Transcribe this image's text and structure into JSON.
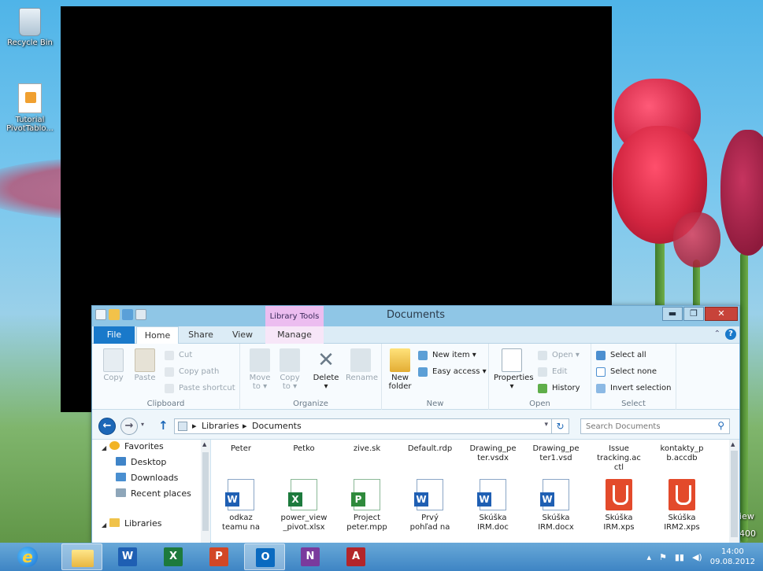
{
  "desktop": {
    "icons": [
      {
        "label": "Recycle Bin"
      },
      {
        "label_line1": "Tutorial",
        "label_line2": "PivotTablo..."
      }
    ],
    "right_edge_text": {
      "line1": "iew",
      "line2": "400"
    }
  },
  "explorer": {
    "title": "Documents",
    "contextual_tab_group": "Library Tools",
    "window_buttons": {
      "minimize": "▬",
      "maximize": "❐",
      "close": "✕"
    },
    "tabs": {
      "file": "File",
      "home": "Home",
      "share": "Share",
      "view": "View",
      "manage": "Manage"
    },
    "ribbon": {
      "clipboard": {
        "label": "Clipboard",
        "copy": "Copy",
        "paste": "Paste",
        "cut": "Cut",
        "copy_path": "Copy path",
        "paste_shortcut": "Paste shortcut"
      },
      "organize": {
        "label": "Organize",
        "move_to_1": "Move",
        "move_to_2": "to ▾",
        "copy_to_1": "Copy",
        "copy_to_2": "to ▾",
        "delete": "Delete",
        "delete_caret": "▾",
        "rename": "Rename"
      },
      "new": {
        "label": "New",
        "new_folder_1": "New",
        "new_folder_2": "folder",
        "new_item": "New item ▾",
        "easy_access": "Easy access ▾"
      },
      "open": {
        "label": "Open",
        "properties": "Properties",
        "properties_caret": "▾",
        "open": "Open ▾",
        "edit": "Edit",
        "history": "History"
      },
      "select": {
        "label": "Select",
        "select_all": "Select all",
        "select_none": "Select none",
        "invert_selection": "Invert selection"
      }
    },
    "address": {
      "back": "←",
      "forward": "→",
      "recent_caret": "▾",
      "up": "↑",
      "crumb_sep1": "▸",
      "crumb1": "Libraries",
      "crumb_sep2": "▸",
      "crumb2": "Documents",
      "dropdown": "▾",
      "refresh": "↻",
      "search_placeholder": "Search Documents",
      "search_icon": "⚲"
    },
    "navpane": {
      "favorites": "Favorites",
      "desktop": "Desktop",
      "downloads": "Downloads",
      "recent_places": "Recent places",
      "libraries": "Libraries",
      "caret_open": "◢"
    },
    "files_row1": [
      {
        "name": "Peter"
      },
      {
        "name": "Petko"
      },
      {
        "name": "zive.sk"
      },
      {
        "name": "Default.rdp"
      },
      {
        "name": "Drawing_pe",
        "name2": "ter.vsdx"
      },
      {
        "name": "Drawing_pe",
        "name2": "ter1.vsd"
      },
      {
        "name": "Issue",
        "name2": "tracking.ac",
        "name3": "ctl"
      },
      {
        "name": "kontakty_p",
        "name2": "b.accdb"
      }
    ],
    "files_row2": [
      {
        "name": "odkaz",
        "name2": "teamu na",
        "type": "word"
      },
      {
        "name": "power_view",
        "name2": "_pivot.xlsx",
        "type": "excel"
      },
      {
        "name": "Project",
        "name2": "peter.mpp",
        "type": "project"
      },
      {
        "name": "Prvý",
        "name2": "pohľad na",
        "type": "word"
      },
      {
        "name": "Skúška",
        "name2": "IRM.doc",
        "type": "word"
      },
      {
        "name": "Skúška",
        "name2": "IRM.docx",
        "type": "word"
      },
      {
        "name": "Skúška",
        "name2": "IRM.xps",
        "type": "xps"
      },
      {
        "name": "Skúška",
        "name2": "IRM2.xps",
        "type": "xps"
      }
    ]
  },
  "taskbar": {
    "apps": [
      {
        "name": "internet-explorer",
        "glyph": "e"
      },
      {
        "name": "file-explorer"
      },
      {
        "name": "word",
        "glyph": "W",
        "color": "#1f5fb3"
      },
      {
        "name": "excel",
        "glyph": "X",
        "color": "#1d7a3d"
      },
      {
        "name": "powerpoint",
        "glyph": "P",
        "color": "#d24726"
      },
      {
        "name": "outlook",
        "glyph": "O",
        "color": "#0a6ac0"
      },
      {
        "name": "onenote",
        "glyph": "N",
        "color": "#7a3b9d"
      },
      {
        "name": "access",
        "glyph": "A",
        "color": "#b3252a"
      }
    ],
    "tray": {
      "up": "▴",
      "flag": "⚑",
      "network": "▮▮",
      "volume": "◀)"
    },
    "clock": {
      "time": "14:00",
      "date": "09.08.2012"
    }
  },
  "colors": {
    "accent": "#1979ca",
    "contextual_tab": "#ecbdf0",
    "close_button": "#c7433a"
  }
}
